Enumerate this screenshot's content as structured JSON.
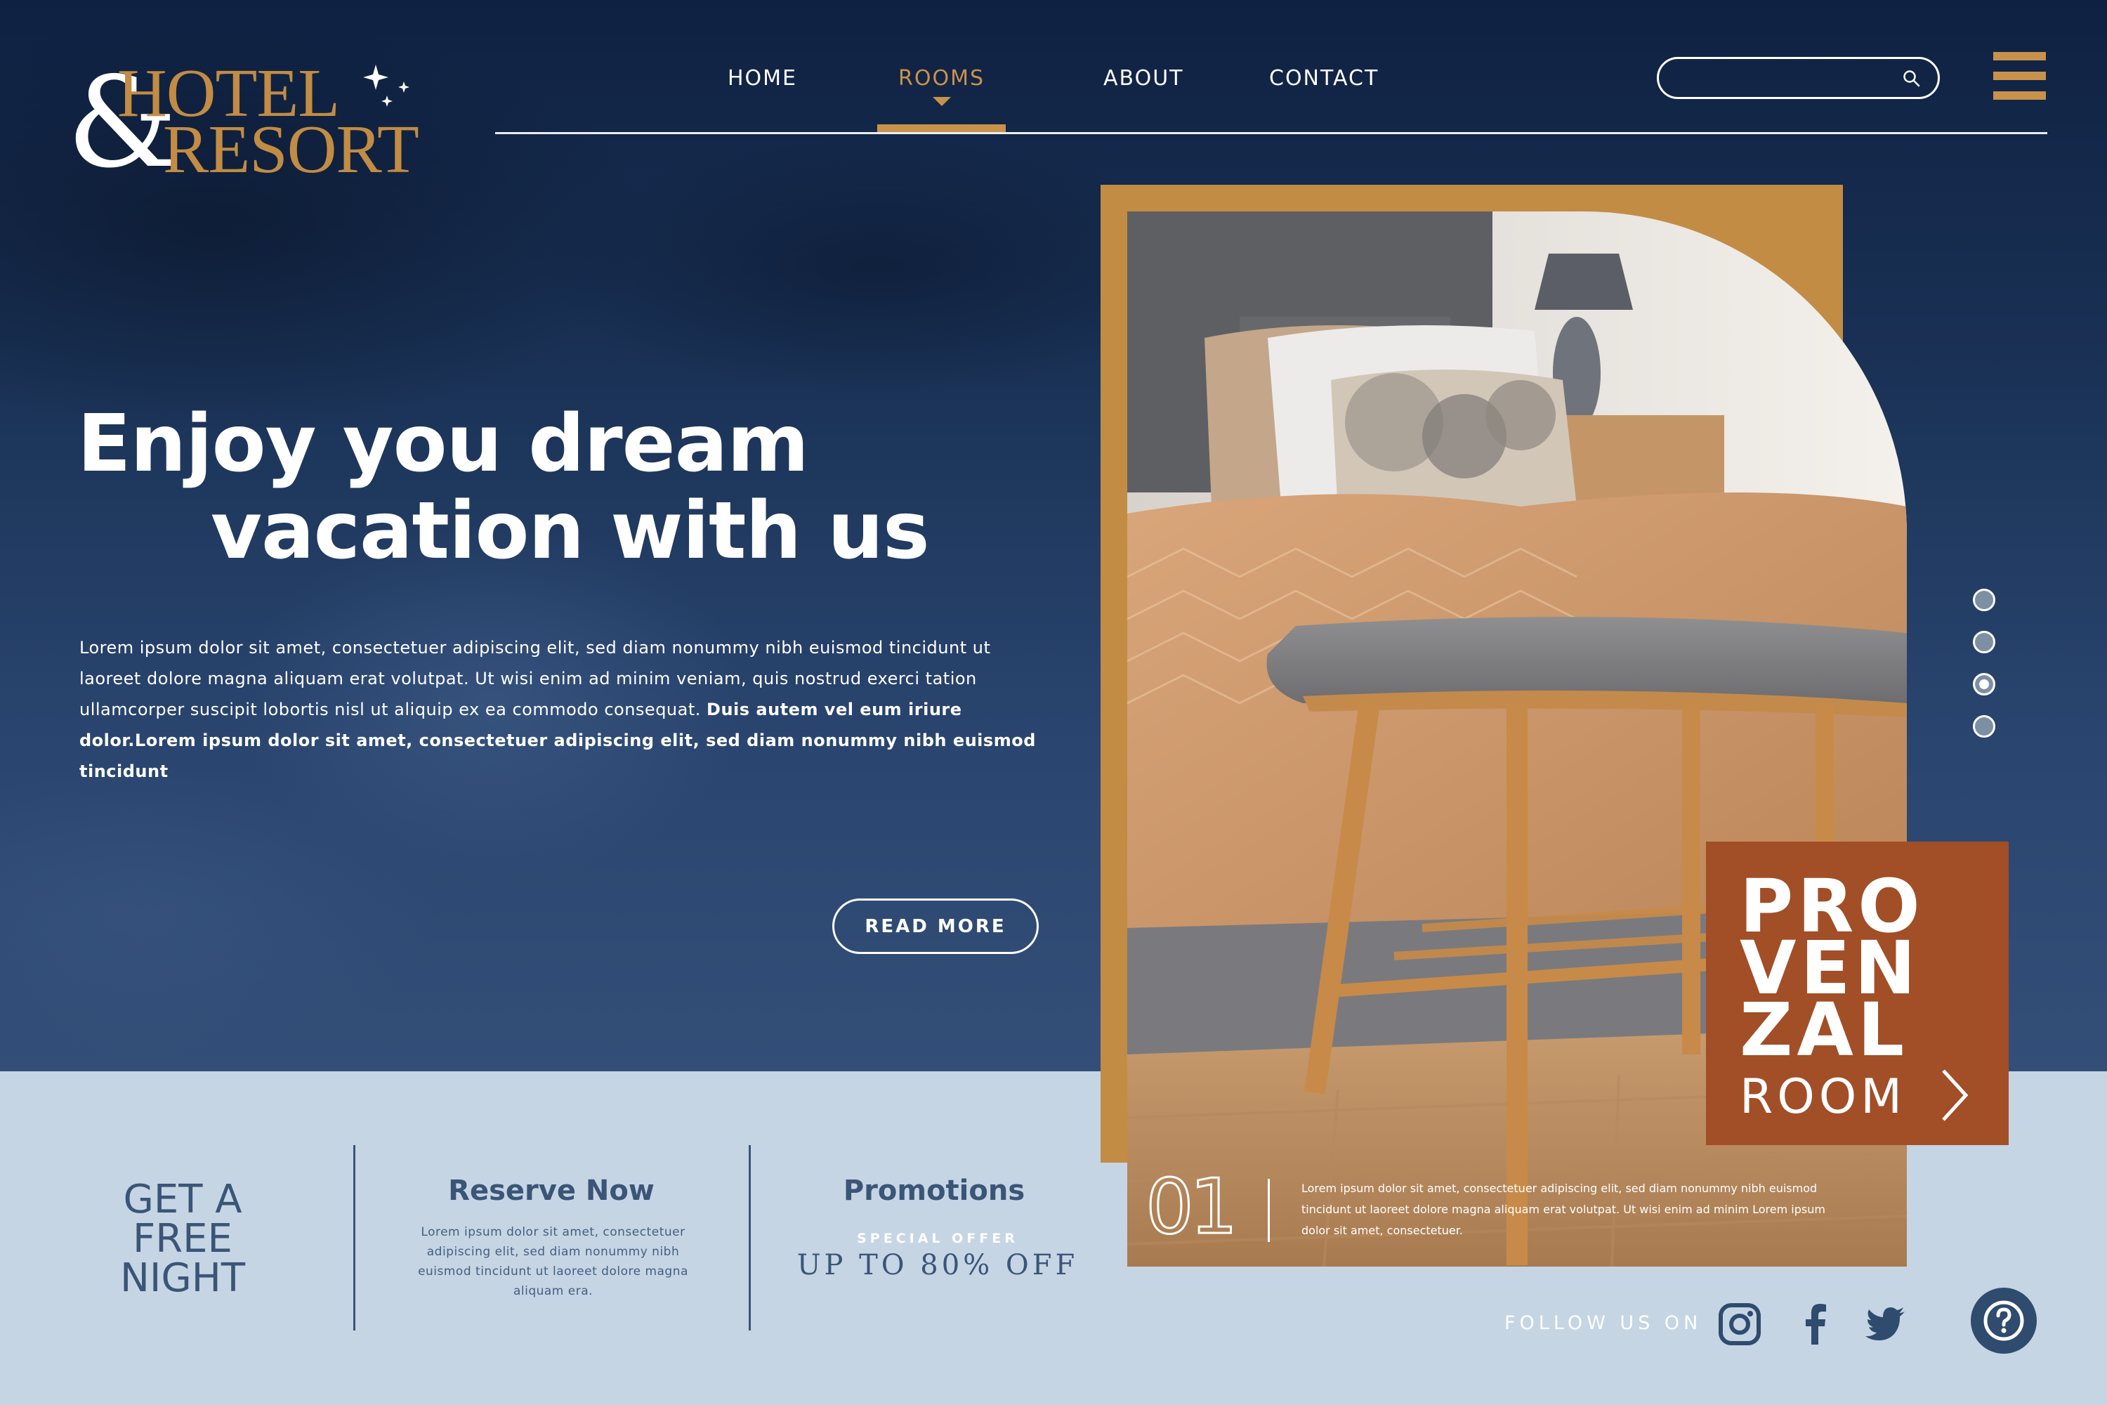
{
  "brand": {
    "amp": "&",
    "line1": "HOTEL",
    "line2": "RESORT"
  },
  "nav": {
    "items": [
      {
        "label": "HOME"
      },
      {
        "label": "ROOMS"
      },
      {
        "label": "ABOUT"
      },
      {
        "label": "CONTACT"
      }
    ],
    "active_index": 1
  },
  "search": {
    "placeholder": "",
    "value": ""
  },
  "hero": {
    "headline_line1": "Enjoy you dream",
    "headline_line2": "vacation with us",
    "body_regular": "Lorem ipsum dolor sit amet, consectetuer adipiscing elit, sed diam nonummy nibh euismod tincidunt ut laoreet dolore magna aliquam erat volutpat. Ut wisi enim ad minim veniam, quis nostrud exerci tation ullamcorper suscipit lobortis nisl ut aliquip ex ea commodo consequat.",
    "body_bold": "Duis autem vel eum iriure dolor.Lorem ipsum dolor sit amet, consectetuer adipiscing elit, sed diam nonummy nibh euismod tincidunt",
    "cta_label": "READ MORE"
  },
  "room_card": {
    "number": "01",
    "caption": "Lorem ipsum dolor sit amet, consectetuer adipiscing elit, sed diam nonummy nibh euismod tincidunt ut laoreet dolore magna aliquam erat volutpat. Ut wisi enim ad minim Lorem ipsum dolor sit amet, consectetuer.",
    "tag_line1": "PRO",
    "tag_line2": "VEN",
    "tag_line3": "ZAL",
    "tag_line4": "ROOM"
  },
  "slider": {
    "count": 4,
    "active_index": 2
  },
  "bottom": {
    "free_night_line1": "GET A",
    "free_night_line2": "FREE",
    "free_night_line3": "NIGHT",
    "reserve_title": "Reserve Now",
    "reserve_text": "Lorem ipsum dolor sit amet, consectetuer adipiscing elit, sed diam nonummy nibh euismod tincidunt ut laoreet dolore magna aliquam era.",
    "promo_title": "Promotions",
    "special_offer": "SPECIAL OFFER",
    "discount": "UP TO 80% OFF"
  },
  "social": {
    "follow_label": "FOLLOW US ON",
    "icons": [
      "instagram-icon",
      "facebook-icon",
      "twitter-icon"
    ]
  },
  "help": {
    "icon": "question-mark-icon"
  },
  "colors": {
    "navy": "#1a3256",
    "gold": "#c9924a",
    "rust": "#a24e27",
    "light_blue": "#c5d5e4",
    "slate_text": "#3b5577"
  }
}
